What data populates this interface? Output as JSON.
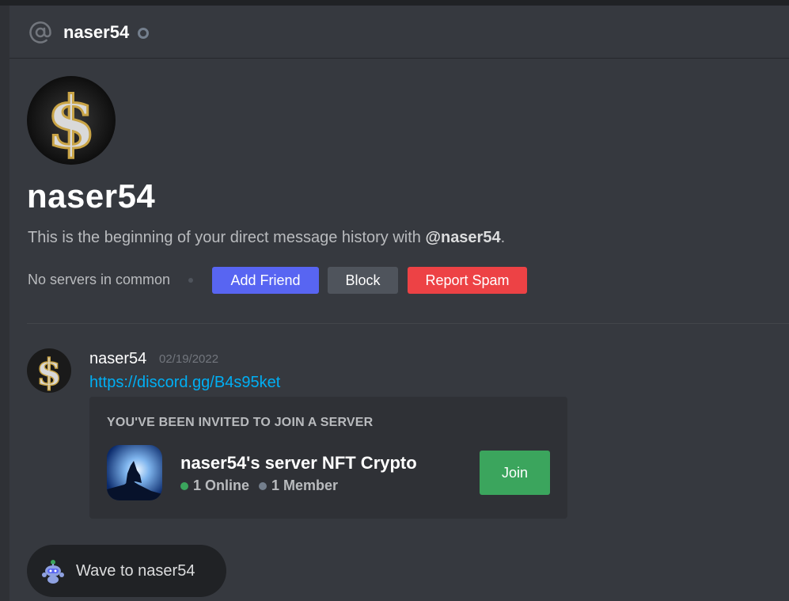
{
  "header": {
    "username": "naser54",
    "status": "offline"
  },
  "profile": {
    "name": "naser54",
    "intro_prefix": "This is the beginning of your direct message history with ",
    "intro_mention": "@naser54",
    "intro_suffix": ".",
    "mutual_servers": "No servers in common"
  },
  "actions": {
    "add_friend": "Add Friend",
    "block": "Block",
    "report_spam": "Report Spam"
  },
  "message": {
    "author": "naser54",
    "timestamp": "02/19/2022",
    "link": "https://discord.gg/B4s95ket"
  },
  "invite": {
    "heading": "YOU'VE BEEN INVITED TO JOIN A SERVER",
    "server_name": "naser54's server NFT Crypto",
    "online": "1 Online",
    "members": "1 Member",
    "join_label": "Join"
  },
  "wave": {
    "label": "Wave to naser54"
  },
  "colors": {
    "background": "#36393f",
    "blurple": "#5865f2",
    "red": "#ed4245",
    "green": "#3ba55d",
    "link": "#00aff4"
  },
  "icons": {
    "header": "at-sign-icon",
    "status": "offline-status-icon",
    "wave": "wumpus-wave-icon"
  }
}
